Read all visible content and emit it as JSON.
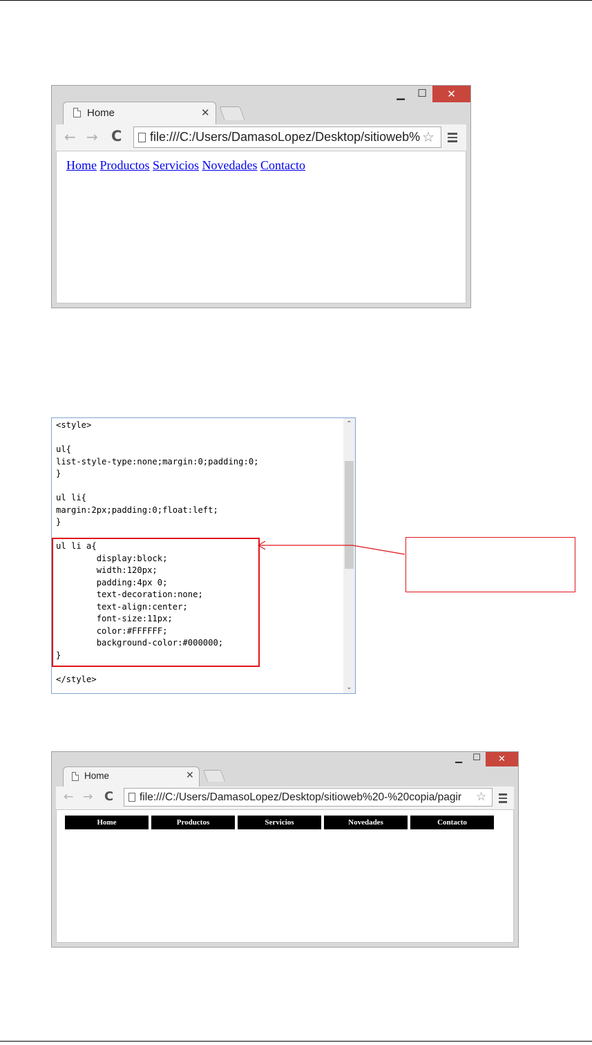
{
  "browser1": {
    "tab_title": "Home",
    "address": "file:///C:/Users/DamasoLopez/Desktop/sitioweb%",
    "links": [
      "Home",
      "Productos",
      "Servicios",
      "Novedades",
      "Contacto"
    ]
  },
  "code": {
    "lines": [
      "<style>",
      "",
      "ul{",
      "list-style-type:none;margin:0;padding:0;",
      "}",
      "",
      "ul li{",
      "margin:2px;padding:0;float:left;",
      "}",
      "",
      "ul li a{",
      "        display:block;",
      "        width:120px;",
      "        padding:4px 0;",
      "        text-decoration:none;",
      "        text-align:center;",
      "        font-size:11px;",
      "        color:#FFFFFF;",
      "        background-color:#000000;",
      "}",
      "",
      "</style>"
    ]
  },
  "browser2": {
    "tab_title": "Home",
    "address": "file:///C:/Users/DamasoLopez/Desktop/sitioweb%20-%20copia/pagir",
    "links": [
      "Home",
      "Productos",
      "Servicios",
      "Novedades",
      "Contacto"
    ]
  },
  "colors": {
    "highlight": "#e0151b",
    "close_button": "#c9463d",
    "link_blue": "#0000ee",
    "nav_background": "#000000",
    "nav_text": "#FFFFFF"
  }
}
